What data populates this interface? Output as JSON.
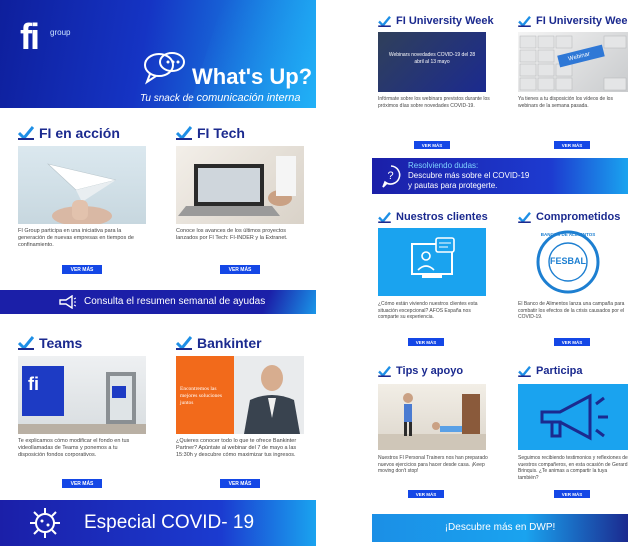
{
  "header": {
    "logo": "fi",
    "logo_sub": "group",
    "title": "What's Up?",
    "subtitle_a": "Tu snack de",
    "subtitle_b": "comunicación interna"
  },
  "left": {
    "fi_accion": {
      "title": "FI en acción",
      "text": "FI Group participa en una iniciativa para la generación de nuevas empresas en tiempos de confinamiento.",
      "button": "VER MÁS"
    },
    "fi_tech": {
      "title": "FI Tech",
      "text": "Conoce los avances de los últimos proyectos lanzados por FI Tech: FI-INDER y la Extranet.",
      "button": "VER MÁS"
    },
    "ayudas_band": "Consulta el resumen semanal de ayudas",
    "teams": {
      "title": "Teams",
      "text": "Te explicamos cómo modificar el fondo en tus videollamadas de Teams y ponemos a tu disposición fondos corporativos.",
      "button": "VER MÁS"
    },
    "bankinter": {
      "title": "Bankinter",
      "image_text": "Encontremos las mejores soluciones juntos",
      "text": "¿Quieres conocer todo lo que te ofrece Bankinter Partner? Apúntate al webinar del 7 de mayo a las 15:30h y descubre cómo maximizar tus ingresos.",
      "button": "VER MÁS"
    },
    "covid_band": "Especial COVID- 19"
  },
  "right": {
    "university_week": {
      "title": "FI University Week",
      "image_text": "Webinars novedades COVID-19 del 28 abril al 13 mayo",
      "text": "Infórmate sobre los webinars previstos durante los próximos días sobre novedades COVID-19.",
      "button": "VER MÁS"
    },
    "university_week2": {
      "title": "FI University Week",
      "image_text": "Webinar",
      "text": "Ya tienes a tu disposición los vídeos de los webinars de la semana pasada.",
      "button": "VER MÁS"
    },
    "dudas_band": {
      "line1": "Resolviendo dudas:",
      "line2": "Descubre más sobre el COVID-19",
      "line3": "y pautas para protegerte."
    },
    "clientes": {
      "title": "Nuestros clientes",
      "text": "¿Cómo están viviendo nuestros clientes esta situación excepcional? AFOS España nos comparte su experiencia.",
      "button": "VER MÁS"
    },
    "comprometidos": {
      "title": "Comprometidos",
      "badge_main": "FESBAL",
      "badge_ring": "BANCOS DE ALIMENTOS",
      "text": "El Banco de Alimentos lanza una campaña para combatir los efectos de la crisis causados por el COVID-19.",
      "button": "VER MÁS"
    },
    "tips": {
      "title": "Tips y apoyo",
      "text": "Nuestros FI Personal Trainers nos han preparado nuevos ejercicios para hacer desde casa. ¡Keep moving don't stop!",
      "button": "VER MÁS"
    },
    "participa": {
      "title": "Participa",
      "text": "Seguimos recibiendo testimonios y reflexiones de vuestros compañeros, en esta ocasión de Gerard Brinquis. ¿Te animas a compartir la tuya también?",
      "button": "VER MÁS"
    },
    "dwp_band": "¡Descubre más en DWP!"
  },
  "colors": {
    "navy": "#1b2a8f",
    "blue": "#1447e6",
    "cyan": "#1aa3ef"
  }
}
